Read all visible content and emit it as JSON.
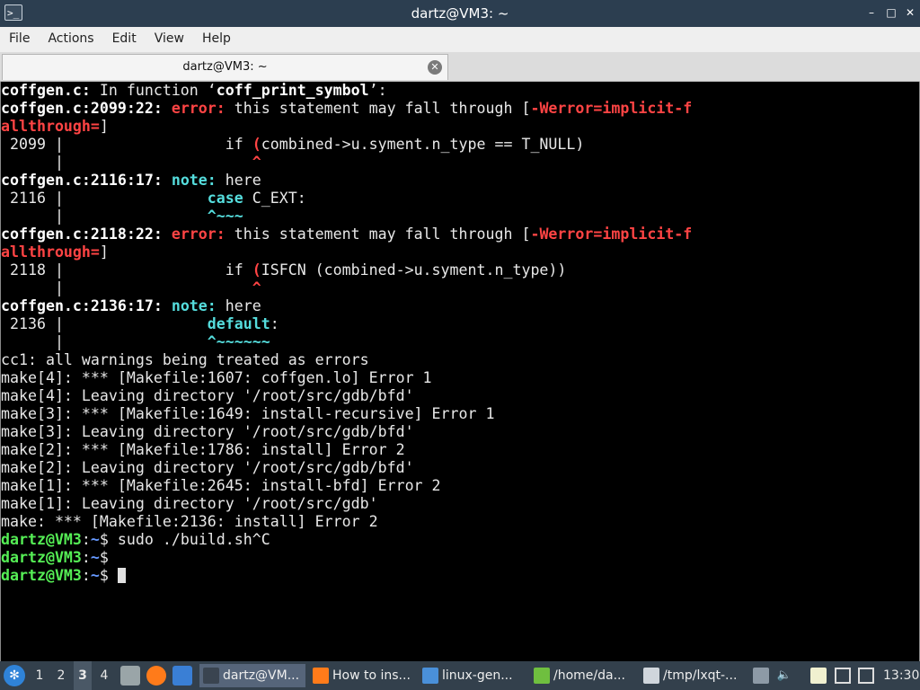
{
  "window": {
    "title": "dartz@VM3: ~",
    "buttons": {
      "minimize": "–",
      "maximize": "□",
      "close": "✕"
    }
  },
  "menu": [
    "File",
    "Actions",
    "Edit",
    "View",
    "Help"
  ],
  "tab": {
    "label": "dartz@VM3: ~",
    "close": "✕"
  },
  "terminal": {
    "lines": [
      [
        {
          "t": "coffgen.c:",
          "c": "b"
        },
        {
          "t": " In function ‘"
        },
        {
          "t": "coff_print_symbol",
          "c": "b"
        },
        {
          "t": "’:"
        }
      ],
      [
        {
          "t": "coffgen.c:2099:22: ",
          "c": "b"
        },
        {
          "t": "error: ",
          "c": "err"
        },
        {
          "t": "this statement may fall through ["
        },
        {
          "t": "-Werror=implicit-f",
          "c": "errtxt"
        }
      ],
      [
        {
          "t": "allthrough=",
          "c": "errtxt"
        },
        {
          "t": "]"
        }
      ],
      [
        {
          "t": " 2099 |                  if "
        },
        {
          "t": "(",
          "c": "rd"
        },
        {
          "t": "combined->u.syment.n_type == T_NULL)"
        }
      ],
      [
        {
          "t": "      |                     "
        },
        {
          "t": "^",
          "c": "rd"
        }
      ],
      [
        {
          "t": "coffgen.c:2116:17: ",
          "c": "b"
        },
        {
          "t": "note: ",
          "c": "note"
        },
        {
          "t": "here"
        }
      ],
      [
        {
          "t": " 2116 |                "
        },
        {
          "t": "case",
          "c": "cy"
        },
        {
          "t": " C_EXT:"
        }
      ],
      [
        {
          "t": "      |                "
        },
        {
          "t": "^~~~",
          "c": "cy"
        }
      ],
      [
        {
          "t": "coffgen.c:2118:22: ",
          "c": "b"
        },
        {
          "t": "error: ",
          "c": "err"
        },
        {
          "t": "this statement may fall through ["
        },
        {
          "t": "-Werror=implicit-f",
          "c": "errtxt"
        }
      ],
      [
        {
          "t": "allthrough=",
          "c": "errtxt"
        },
        {
          "t": "]"
        }
      ],
      [
        {
          "t": " 2118 |                  if "
        },
        {
          "t": "(",
          "c": "rd"
        },
        {
          "t": "ISFCN (combined->u.syment.n_type))"
        }
      ],
      [
        {
          "t": "      |                     "
        },
        {
          "t": "^",
          "c": "rd"
        }
      ],
      [
        {
          "t": "coffgen.c:2136:17: ",
          "c": "b"
        },
        {
          "t": "note: ",
          "c": "note"
        },
        {
          "t": "here"
        }
      ],
      [
        {
          "t": " 2136 |                "
        },
        {
          "t": "default",
          "c": "cy"
        },
        {
          "t": ":"
        }
      ],
      [
        {
          "t": "      |                "
        },
        {
          "t": "^~~~~~~",
          "c": "cy"
        }
      ],
      [
        {
          "t": "cc1: all warnings being treated as errors"
        }
      ],
      [
        {
          "t": "make[4]: *** [Makefile:1607: coffgen.lo] Error 1"
        }
      ],
      [
        {
          "t": "make[4]: Leaving directory '/root/src/gdb/bfd'"
        }
      ],
      [
        {
          "t": "make[3]: *** [Makefile:1649: install-recursive] Error 1"
        }
      ],
      [
        {
          "t": "make[3]: Leaving directory '/root/src/gdb/bfd'"
        }
      ],
      [
        {
          "t": "make[2]: *** [Makefile:1786: install] Error 2"
        }
      ],
      [
        {
          "t": "make[2]: Leaving directory '/root/src/gdb/bfd'"
        }
      ],
      [
        {
          "t": "make[1]: *** [Makefile:2645: install-bfd] Error 2"
        }
      ],
      [
        {
          "t": "make[1]: Leaving directory '/root/src/gdb'"
        }
      ],
      [
        {
          "t": "make: *** [Makefile:2136: install] Error 2"
        }
      ],
      [
        {
          "t": "dartz@VM3",
          "c": "pg"
        },
        {
          "t": ":"
        },
        {
          "t": "~",
          "c": "pb"
        },
        {
          "t": "$ sudo ./build.sh^C"
        }
      ],
      [
        {
          "t": "dartz@VM3",
          "c": "pg"
        },
        {
          "t": ":"
        },
        {
          "t": "~",
          "c": "pb"
        },
        {
          "t": "$"
        }
      ],
      [
        {
          "t": "dartz@VM3",
          "c": "pg"
        },
        {
          "t": ":"
        },
        {
          "t": "~",
          "c": "pb"
        },
        {
          "t": "$ "
        },
        {
          "cursor": true
        }
      ]
    ]
  },
  "taskbar": {
    "desktops": [
      "1",
      "2",
      "3",
      "4"
    ],
    "active_desktop": "3",
    "tasks": [
      {
        "label": "dartz@VM...",
        "icon": "terminal-icon",
        "active": true
      },
      {
        "label": "How to ins...",
        "icon": "firefox-icon",
        "active": false
      },
      {
        "label": "linux-gen...",
        "icon": "folder-icon",
        "active": false
      },
      {
        "label": "/home/da...",
        "icon": "text-editor-icon",
        "active": false
      },
      {
        "label": "/tmp/lxqt-...",
        "icon": "pencil-icon",
        "active": false
      }
    ],
    "clock": "13:30"
  },
  "colors": {
    "terminal_bg": "#000000",
    "titlebar": "#2c3e50",
    "taskbar": "#33404c",
    "prompt_user": "#55ee55",
    "prompt_path": "#6699ff",
    "error": "#ff4444",
    "note": "#55dddd"
  }
}
